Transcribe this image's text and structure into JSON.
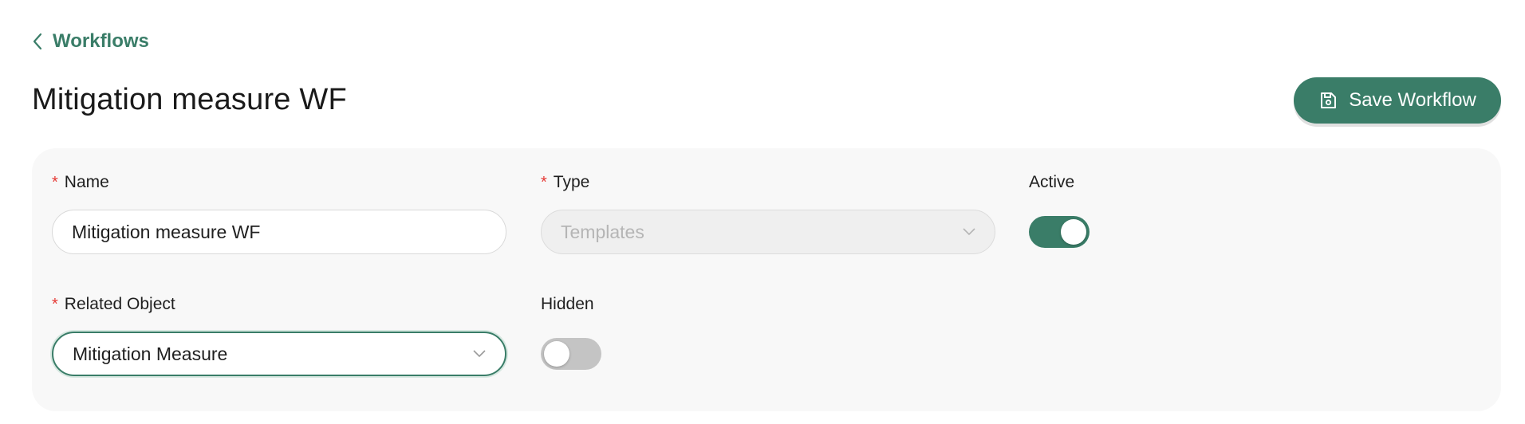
{
  "breadcrumb": {
    "label": "Workflows",
    "icon": "chevron-left-icon"
  },
  "page": {
    "title": "Mitigation measure WF"
  },
  "toolbar": {
    "save_label": "Save Workflow",
    "save_icon": "save-icon"
  },
  "form": {
    "required_marker": "*",
    "name": {
      "label": "Name",
      "value": "Mitigation measure WF",
      "required": true
    },
    "type": {
      "label": "Type",
      "value": "Templates",
      "required": true,
      "disabled": true
    },
    "active": {
      "label": "Active",
      "checked": true
    },
    "related_object": {
      "label": "Related Object",
      "value": "Mitigation Measure",
      "required": true,
      "focused": true
    },
    "hidden": {
      "label": "Hidden",
      "checked": false
    }
  },
  "colors": {
    "accent": "#3a7d68",
    "required": "#e53935",
    "panel_bg": "#f8f8f8",
    "toggle_off": "#c4c4c4"
  }
}
